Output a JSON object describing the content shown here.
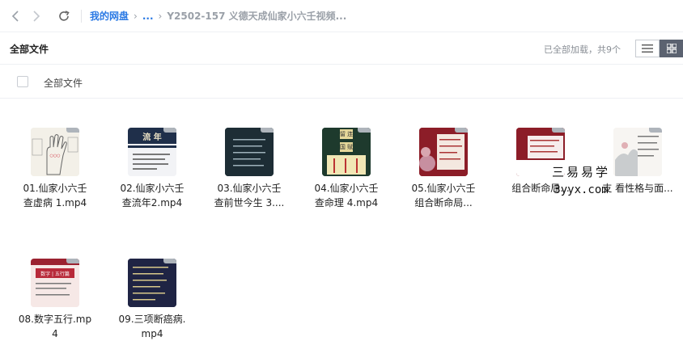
{
  "nav": {
    "breadcrumb_root": "我的网盘",
    "breadcrumb_ellipsis": "...",
    "breadcrumb_current": "Y2502-157 义德天成仙家小六壬视频..."
  },
  "toolbar": {
    "title": "全部文件",
    "load_status": "已全部加载，共9个"
  },
  "select_bar": {
    "label": "全部文件"
  },
  "files": [
    {
      "line1": "01.仙家小六壬",
      "line2": "查虚病 1.mp4"
    },
    {
      "line1": "02.仙家小六壬",
      "line2": "查流年2.mp4"
    },
    {
      "line1": "03.仙家小六壬",
      "line2": "查前世今生 3...."
    },
    {
      "line1": "04.仙家小六壬",
      "line2": "查命理 4.mp4"
    },
    {
      "line1": "05.仙家小六壬",
      "line2": "组合断命局..."
    },
    {
      "line1": "",
      "line2": "组合断命局..."
    },
    {
      "line1": "",
      "line2": "支 看性格与面..."
    },
    {
      "line1": "08.数字五行.mp",
      "line2": "4"
    },
    {
      "line1": "09.三项断癌病.",
      "line2": "mp4"
    }
  ],
  "thumbnails": {
    "t2_title": "流  年",
    "t4_top": "留  连",
    "t4_mid": "国  赋",
    "t8_title": "数字 | 五行篇"
  },
  "watermark": {
    "cn": "三易易学",
    "en": "3yyx.com"
  },
  "colors": {
    "link": "#2a79e4",
    "muted": "#9aa0a8",
    "toggle_active": "#5b6270"
  }
}
